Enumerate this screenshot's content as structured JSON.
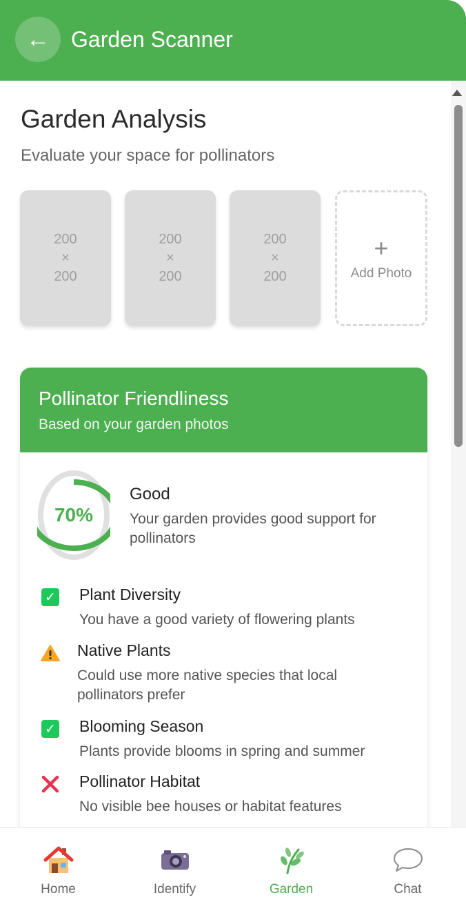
{
  "header": {
    "back_icon": "←",
    "title": "Garden Scanner"
  },
  "page": {
    "title": "Garden Analysis",
    "subtitle": "Evaluate your space for pollinators"
  },
  "photos": [
    {
      "line1": "200",
      "line2": "×",
      "line3": "200"
    },
    {
      "line1": "200",
      "line2": "×",
      "line3": "200"
    },
    {
      "line1": "200",
      "line2": "×",
      "line3": "200"
    }
  ],
  "add_photo": {
    "icon": "+",
    "label": "Add Photo"
  },
  "card": {
    "title": "Pollinator Friendliness",
    "subtitle": "Based on your garden photos",
    "score": {
      "value": "70%",
      "fraction": 0.7,
      "label": "Good",
      "description": "Your garden provides good support for pollinators"
    },
    "criteria": [
      {
        "status": "check",
        "title": "Plant Diversity",
        "description": "You have a good variety of flowering plants"
      },
      {
        "status": "warning",
        "title": "Native Plants",
        "description": "Could use more native species that local pollinators prefer"
      },
      {
        "status": "check",
        "title": "Blooming Season",
        "description": "Plants provide blooms in spring and summer"
      },
      {
        "status": "cross",
        "title": "Pollinator Habitat",
        "description": "No visible bee houses or habitat features"
      }
    ]
  },
  "nav": {
    "items": [
      {
        "label": "Home",
        "icon": "house-icon"
      },
      {
        "label": "Identify",
        "icon": "camera-icon"
      },
      {
        "label": "Garden",
        "icon": "seedling-icon",
        "active": true
      },
      {
        "label": "Chat",
        "icon": "speech-bubble-icon"
      }
    ]
  },
  "colors": {
    "primary": "#4caf50",
    "check": "#1ec95b",
    "warning": "#f5a623",
    "cross": "#e8344e"
  }
}
